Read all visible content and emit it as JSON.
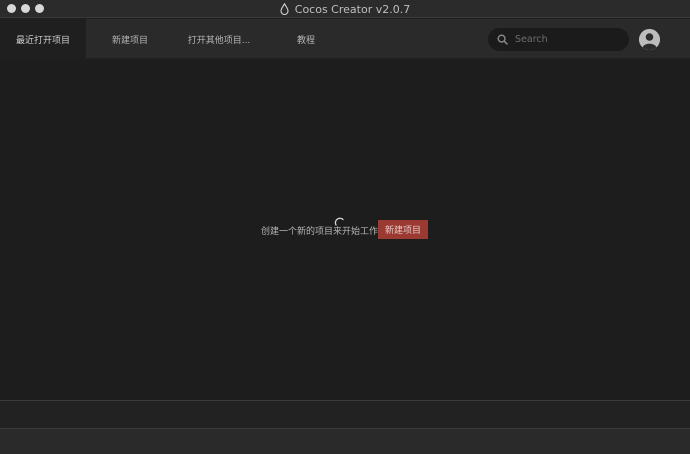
{
  "window": {
    "title": "Cocos Creator v2.0.7",
    "logo_icon": "cocos-droplet-icon",
    "traffic_lights": [
      "close",
      "minimize",
      "zoom"
    ]
  },
  "nav": {
    "tabs": [
      {
        "label": "最近打开项目",
        "active": true
      },
      {
        "label": "新建项目",
        "active": false
      },
      {
        "label": "打开其他项目...",
        "active": false
      },
      {
        "label": "教程",
        "active": false
      }
    ]
  },
  "search": {
    "placeholder": "Search",
    "value": "",
    "icon": "search-icon"
  },
  "user": {
    "avatar_icon": "user-avatar-icon"
  },
  "main": {
    "loading_icon": "spinner-icon",
    "empty_message": "创建一个新的项目来开始工作",
    "new_project_button": "新建项目"
  },
  "colors": {
    "accent": "#9b3a33",
    "background": "#1d1d1d",
    "topbar": "#2a2a2a"
  }
}
